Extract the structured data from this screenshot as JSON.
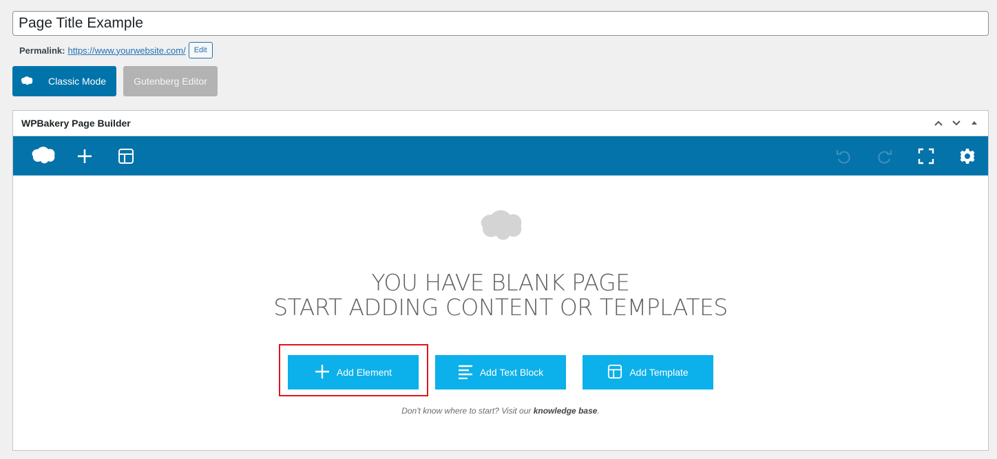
{
  "post": {
    "title_value": "Page Title Example",
    "permalink_label": "Permalink:",
    "permalink_url": "https://www.yourwebsite.com/",
    "edit_label": "Edit"
  },
  "modes": {
    "classic_label": "Classic Mode",
    "gutenberg_label": "Gutenberg Editor"
  },
  "builder": {
    "title": "WPBakery Page Builder",
    "toolbar_icons": [
      "logo-icon",
      "plus-icon",
      "layout-icon",
      "undo-icon",
      "redo-icon",
      "fullscreen-icon",
      "gear-icon"
    ],
    "accent": "#0473aa",
    "button_color": "#0cb0ea"
  },
  "blank": {
    "line1": "YOU HAVE BLANK PAGE",
    "line2": "START ADDING CONTENT OR TEMPLATES",
    "add_element": "Add Element",
    "add_text_block": "Add Text Block",
    "add_template": "Add Template",
    "hint_prefix": "Don't know where to start? Visit our",
    "hint_link": "knowledge base",
    "hint_suffix": "."
  }
}
